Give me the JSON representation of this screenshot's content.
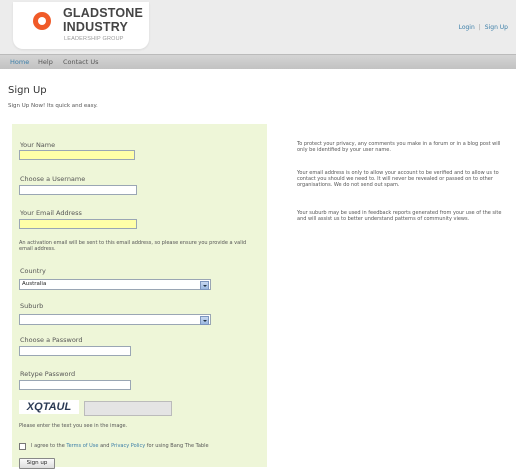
{
  "brand": {
    "line1": "GLADSTONE",
    "line2": "INDUSTRY",
    "sub": "LEADERSHIP GROUP"
  },
  "auth": {
    "login": "Login",
    "separator": "|",
    "signup": "Sign Up"
  },
  "nav": {
    "items": [
      "Home",
      "Help",
      "Contact Us"
    ],
    "active": "Home"
  },
  "page": {
    "title": "Sign Up",
    "subtitle": "Sign Up Now! Its quick and easy."
  },
  "form": {
    "name_label": "Your Name",
    "username_label": "Choose a Username",
    "email_label": "Your Email Address",
    "email_help": "An activation email will be sent to this email address, so please ensure you provide a valid email address.",
    "country_label": "Country",
    "country_value": "Australia",
    "suburb_label": "Suburb",
    "suburb_value": "",
    "password_label": "Choose a Password",
    "retype_label": "Retype Password",
    "captcha_text": "XQTAUL",
    "captcha_help": "Please enter the text you see in the image.",
    "agree_prefix": "I agree to the ",
    "terms_link": "Terms of Use",
    "agree_mid": " and ",
    "privacy_link": "Privacy Policy",
    "agree_suffix": " for using Bang The Table",
    "submit_label": "Sign up"
  },
  "privacy_notes": [
    "To protect your privacy, any comments you make in a forum or in a blog post will only be identified by your user name.",
    "Your email address is only to allow your account to be verified and to allow us to contact you should we need to. It will never be revealed or passed on to other organisations. We do not send out spam.",
    "Your suburb may be used in feedback reports generated from your use of the site and will assist us to better understand patterns of community views."
  ],
  "colors": {
    "accent": "#3b7ea8",
    "logo": "#f05a28",
    "form_bg": "#eef6d8",
    "required_field": "#ffffa8"
  }
}
